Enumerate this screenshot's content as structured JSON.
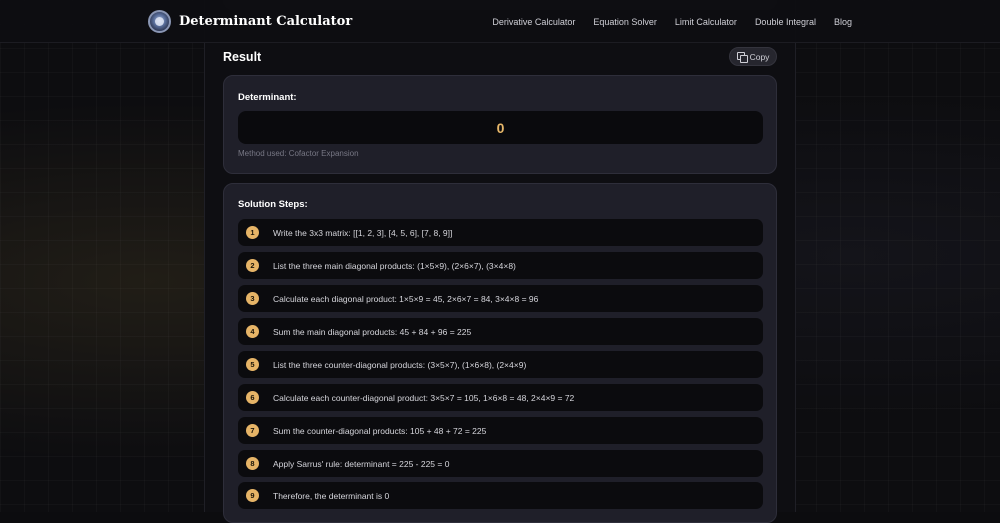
{
  "brand": {
    "title": "Determinant Calculator",
    "logo_icon": "globe-seal-icon"
  },
  "nav": {
    "links": [
      "Derivative Calculator",
      "Equation Solver",
      "Limit Calculator",
      "Double Integral",
      "Blog"
    ]
  },
  "result": {
    "title": "Result",
    "copy_label": "Copy"
  },
  "determinant": {
    "label": "Determinant:",
    "value": "0",
    "method": "Method used: Cofactor Expansion"
  },
  "steps": {
    "label": "Solution Steps:",
    "items": [
      {
        "num": "1",
        "text": "Write the 3x3 matrix: [[1, 2, 3], [4, 5, 6], [7, 8, 9]]"
      },
      {
        "num": "2",
        "text": "List the three main diagonal products: (1×5×9), (2×6×7), (3×4×8)"
      },
      {
        "num": "3",
        "text": "Calculate each diagonal product: 1×5×9 = 45, 2×6×7 = 84, 3×4×8 = 96"
      },
      {
        "num": "4",
        "text": "Sum the main diagonal products: 45 + 84 + 96 = 225"
      },
      {
        "num": "5",
        "text": "List the three counter-diagonal products: (3×5×7), (1×6×8), (2×4×9)"
      },
      {
        "num": "6",
        "text": "Calculate each counter-diagonal product: 3×5×7 = 105, 1×6×8 = 48, 2×4×9 = 72"
      },
      {
        "num": "7",
        "text": "Sum the counter-diagonal products: 105 + 48 + 72 = 225"
      },
      {
        "num": "8",
        "text": "Apply Sarrus' rule: determinant = 225 - 225 = 0"
      },
      {
        "num": "9",
        "text": "Therefore, the determinant is 0"
      }
    ]
  },
  "colors": {
    "accent": "#e6b467",
    "value": "#e8b86a",
    "card": "#1f1f29",
    "row": "#0b0b0e"
  }
}
